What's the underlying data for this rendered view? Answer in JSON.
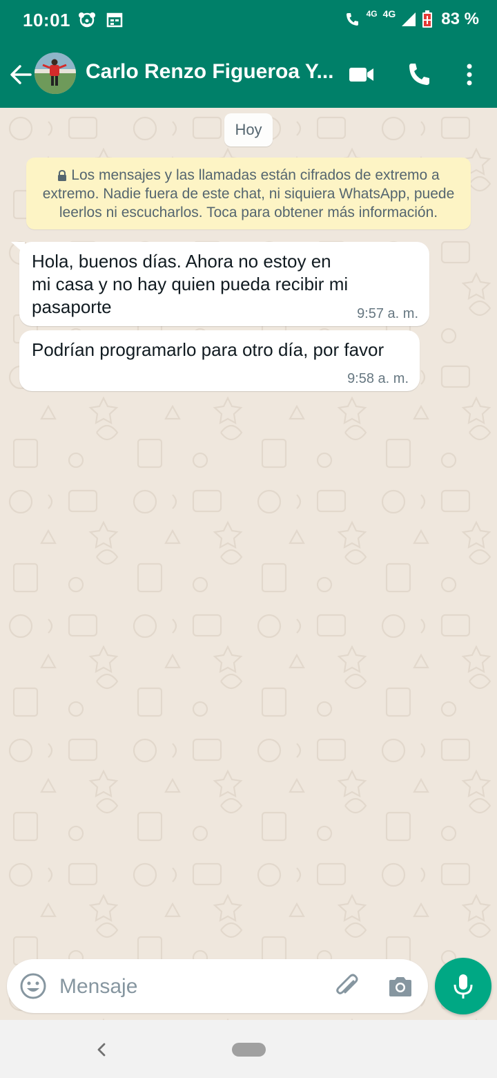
{
  "status_bar": {
    "time": "10:01",
    "network_1": "4G",
    "network_2": "4G",
    "battery_percent": "83 %"
  },
  "header": {
    "contact_name": "Carlo Renzo Figueroa Y...",
    "icons": [
      "back-arrow-icon",
      "video-call-icon",
      "voice-call-icon",
      "more-options-icon"
    ]
  },
  "chat": {
    "date_label": "Hoy",
    "encryption_notice": "Los mensajes y las llamadas están cifrados de extremo a extremo. Nadie fuera de este chat, ni siquiera WhatsApp, puede leerlos ni escucharlos. Toca para obtener más información.",
    "messages": [
      {
        "line1": "Hola, buenos días. Ahora no estoy en",
        "line2": "mi casa y no hay quien pueda recibir mi",
        "line3": "pasaporte",
        "time": "9:57 a. m."
      },
      {
        "line1": "Podrían programarlo para otro día, por favor",
        "time": "9:58 a. m."
      }
    ]
  },
  "composer": {
    "placeholder": "Mensaje",
    "icons": [
      "emoji-icon",
      "paperclip-icon",
      "camera-icon",
      "microphone-icon"
    ]
  },
  "colors": {
    "header": "#008069",
    "chat_background": "#efe7dd",
    "encryption_background": "#fdf4c5",
    "mic_button": "#00a884"
  }
}
